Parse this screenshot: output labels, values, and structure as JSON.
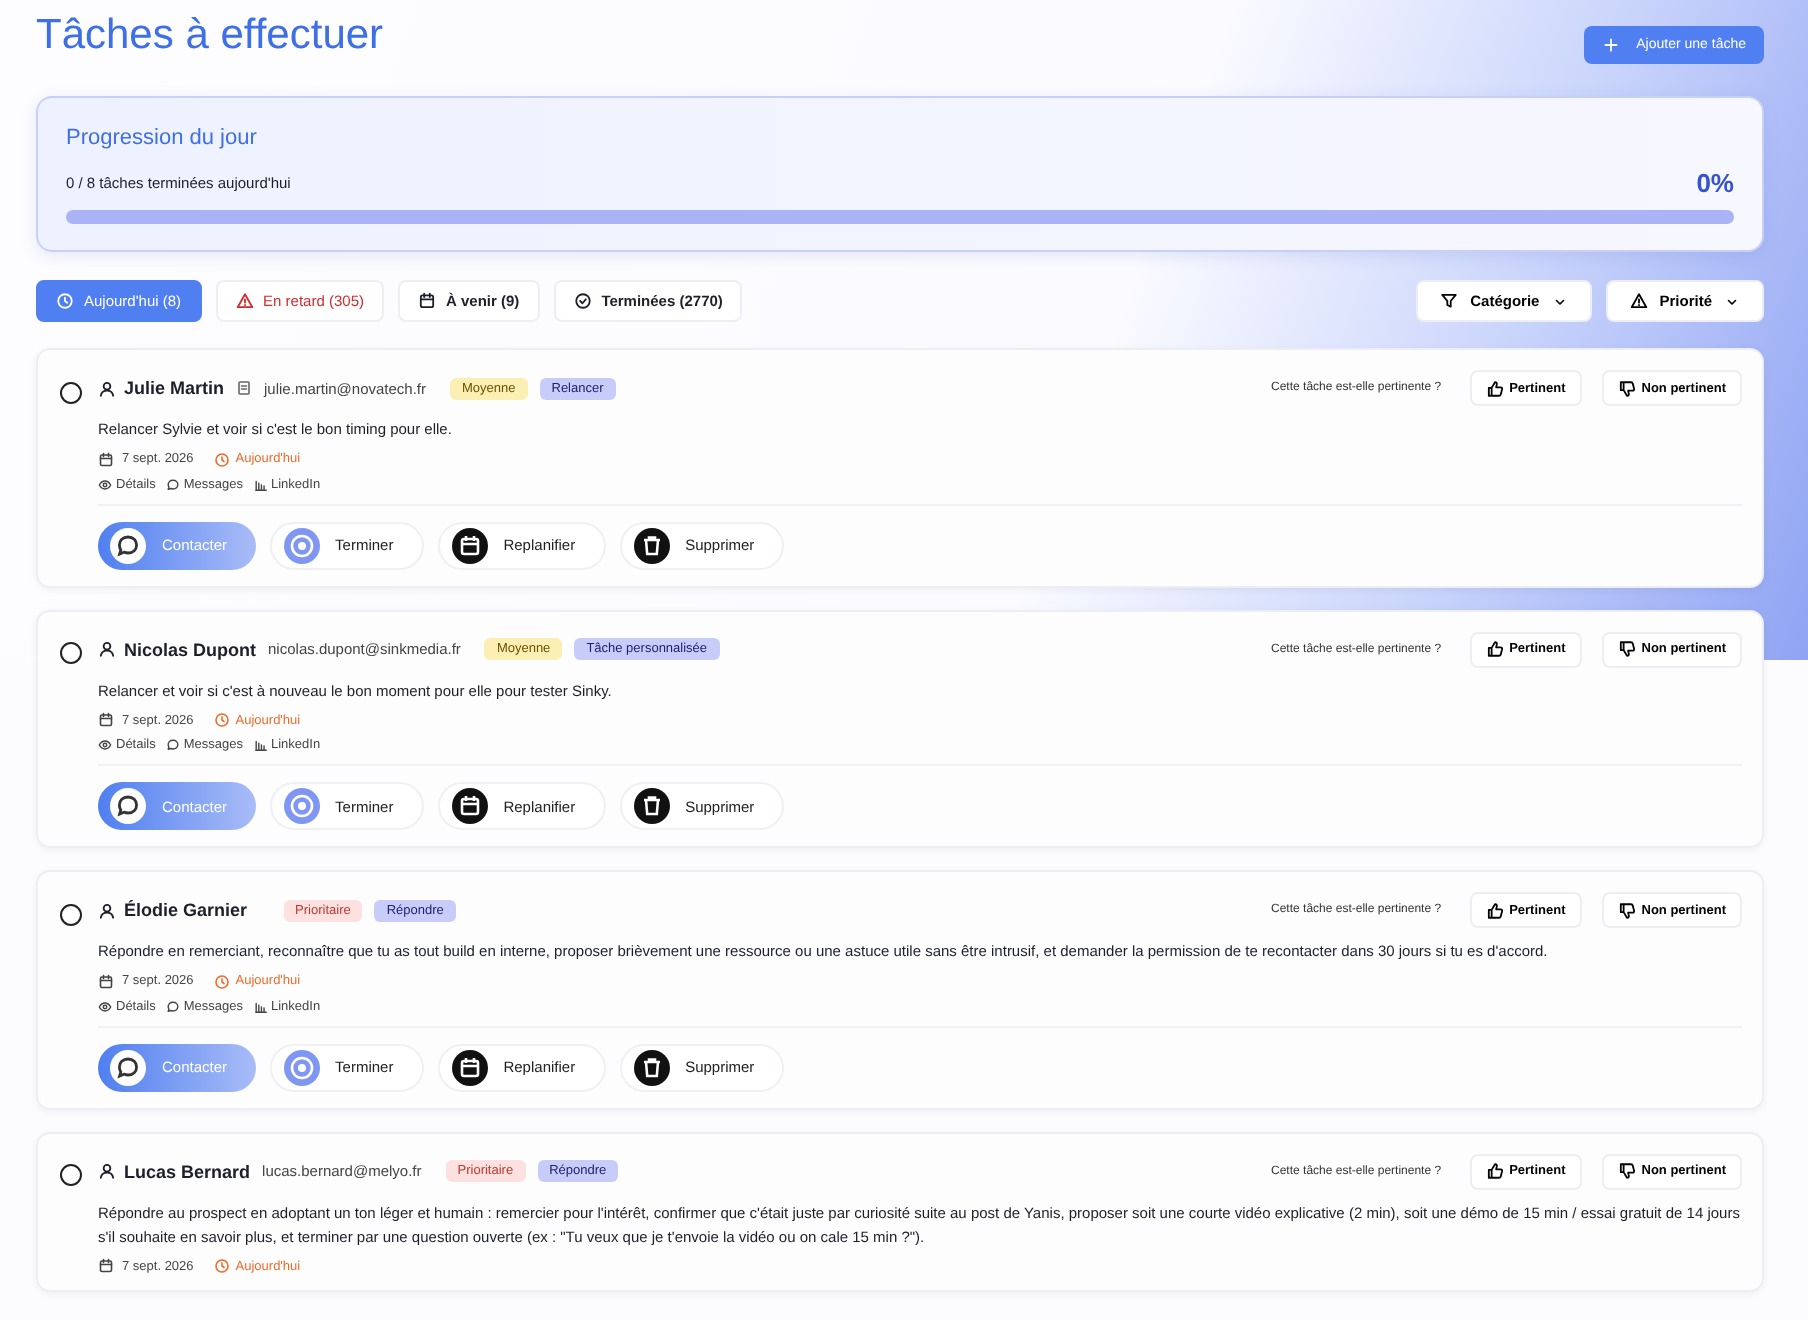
{
  "header": {
    "title": "Tâches à effectuer",
    "add_button": "Ajouter une tâche"
  },
  "progress": {
    "title": "Progression du jour",
    "summary": "0 / 8 tâches terminées aujourd'hui",
    "percent": "0%",
    "level": 0
  },
  "tabs": [
    {
      "kind": "today",
      "label": "Aujourd'hui (8)",
      "selected": true
    },
    {
      "kind": "overdue",
      "label": "En retard (305)",
      "selected": false
    },
    {
      "kind": "upcoming",
      "label": "À venir (9)",
      "selected": false
    },
    {
      "kind": "done",
      "label": "Terminées (2770)",
      "selected": false
    }
  ],
  "filters": [
    {
      "kind": "category",
      "label": "Catégorie"
    },
    {
      "kind": "priority",
      "label": "Priorité"
    }
  ],
  "tasks": [
    {
      "checked": false,
      "name": "Julie Martin",
      "email": "julie.martin@novatech.fr",
      "email_icon": true,
      "priority": {
        "kind": "medium",
        "label": "Moyenne"
      },
      "category": "Relancer",
      "question": "Cette tâche est-elle pertinente ?",
      "relevant": "Pertinent",
      "not_relevant": "Non pertinent",
      "description": "Relancer Sylvie et voir si c'est le bon timing pour elle.",
      "date": "7 sept. 2026",
      "due": "Aujourd'hui",
      "links": [
        {
          "kind": "details",
          "label": "Détails"
        },
        {
          "kind": "messages",
          "label": "Messages"
        },
        {
          "kind": "linkedin",
          "label": "LinkedIn"
        }
      ],
      "actions": [
        {
          "kind": "contact",
          "label": "Contacter"
        },
        {
          "kind": "finish",
          "label": "Terminer"
        },
        {
          "kind": "reschedule",
          "label": "Replanifier"
        },
        {
          "kind": "delete",
          "label": "Supprimer"
        }
      ]
    },
    {
      "checked": false,
      "name": "Nicolas Dupont",
      "email": "nicolas.dupont@sinkmedia.fr",
      "email_icon": false,
      "priority": {
        "kind": "medium",
        "label": "Moyenne"
      },
      "category": "Tâche personnalisée",
      "question": "Cette tâche est-elle pertinente ?",
      "relevant": "Pertinent",
      "not_relevant": "Non pertinent",
      "description": "Relancer et voir si c'est à nouveau le bon moment pour elle pour tester Sinky.",
      "date": "7 sept. 2026",
      "due": "Aujourd'hui",
      "links": [
        {
          "kind": "details",
          "label": "Détails"
        },
        {
          "kind": "messages",
          "label": "Messages"
        },
        {
          "kind": "linkedin",
          "label": "LinkedIn"
        }
      ],
      "actions": [
        {
          "kind": "contact",
          "label": "Contacter"
        },
        {
          "kind": "finish",
          "label": "Terminer"
        },
        {
          "kind": "reschedule",
          "label": "Replanifier"
        },
        {
          "kind": "delete",
          "label": "Supprimer"
        }
      ]
    },
    {
      "checked": false,
      "name": "Élodie Garnier",
      "email_icon": false,
      "priority": {
        "kind": "high",
        "label": "Prioritaire"
      },
      "category": "Répondre",
      "question": "Cette tâche est-elle pertinente ?",
      "relevant": "Pertinent",
      "not_relevant": "Non pertinent",
      "description": "Répondre en remerciant, reconnaître que tu as tout build en interne, proposer brièvement une ressource ou une astuce utile sans être intrusif, et demander la permission de te recontacter dans 30 jours si tu es d'accord.",
      "date": "7 sept. 2026",
      "due": "Aujourd'hui",
      "links": [
        {
          "kind": "details",
          "label": "Détails"
        },
        {
          "kind": "messages",
          "label": "Messages"
        },
        {
          "kind": "linkedin",
          "label": "LinkedIn"
        }
      ],
      "actions": [
        {
          "kind": "contact",
          "label": "Contacter"
        },
        {
          "kind": "finish",
          "label": "Terminer"
        },
        {
          "kind": "reschedule",
          "label": "Replanifier"
        },
        {
          "kind": "delete",
          "label": "Supprimer"
        }
      ]
    },
    {
      "checked": false,
      "name": "Lucas Bernard",
      "email": "lucas.bernard@melyo.fr",
      "email_icon": false,
      "priority": {
        "kind": "high",
        "label": "Prioritaire"
      },
      "category": "Répondre",
      "question": "Cette tâche est-elle pertinente ?",
      "relevant": "Pertinent",
      "not_relevant": "Non pertinent",
      "description": "Répondre au prospect en adoptant un ton léger et humain : remercier pour l'intérêt, confirmer que c'était juste par curiosité suite au post de Yanis, proposer soit une courte vidéo explicative (2 min), soit une démo de 15 min / essai gratuit de 14 jours s'il souhaite en savoir plus, et terminer par une question ouverte (ex : \"Tu veux que je t'envoie la vidéo ou on cale 15 min ?\").",
      "date": "7 sept. 2026",
      "due": "Aujourd'hui"
    }
  ]
}
